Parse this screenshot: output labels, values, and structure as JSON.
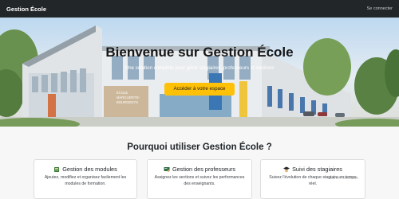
{
  "navbar": {
    "brand": "Gestion École",
    "login_link": "Se connecter"
  },
  "hero": {
    "title": "Bienvenue sur Gestion École",
    "subtitle": "Une solution complète pour gérer stagiaires, professeurs et sections",
    "cta_label": "Accéder à votre espace",
    "building_sign": "ÉCOLE MARGUERITE-BOURGEOYS"
  },
  "features": {
    "heading": "Pourquoi utiliser Gestion École ?",
    "cards": [
      {
        "icon": "module-book-icon",
        "title": "Gestion des modules",
        "text": "Ajoutez, modifiez et organisez facilement les modules de formation."
      },
      {
        "icon": "teacher-board-icon",
        "title": "Gestion des professeurs",
        "text": "Assignez les sections et suivez les performances des enseignants."
      },
      {
        "icon": "graduate-icon",
        "title": "Suivi des stagiaires",
        "text": "Suivez l'évolution de chaque stagiaire en temps réel."
      }
    ]
  },
  "watermark": "Activer Windows",
  "colors": {
    "navbar": "#222629",
    "accent": "#ffc107"
  }
}
